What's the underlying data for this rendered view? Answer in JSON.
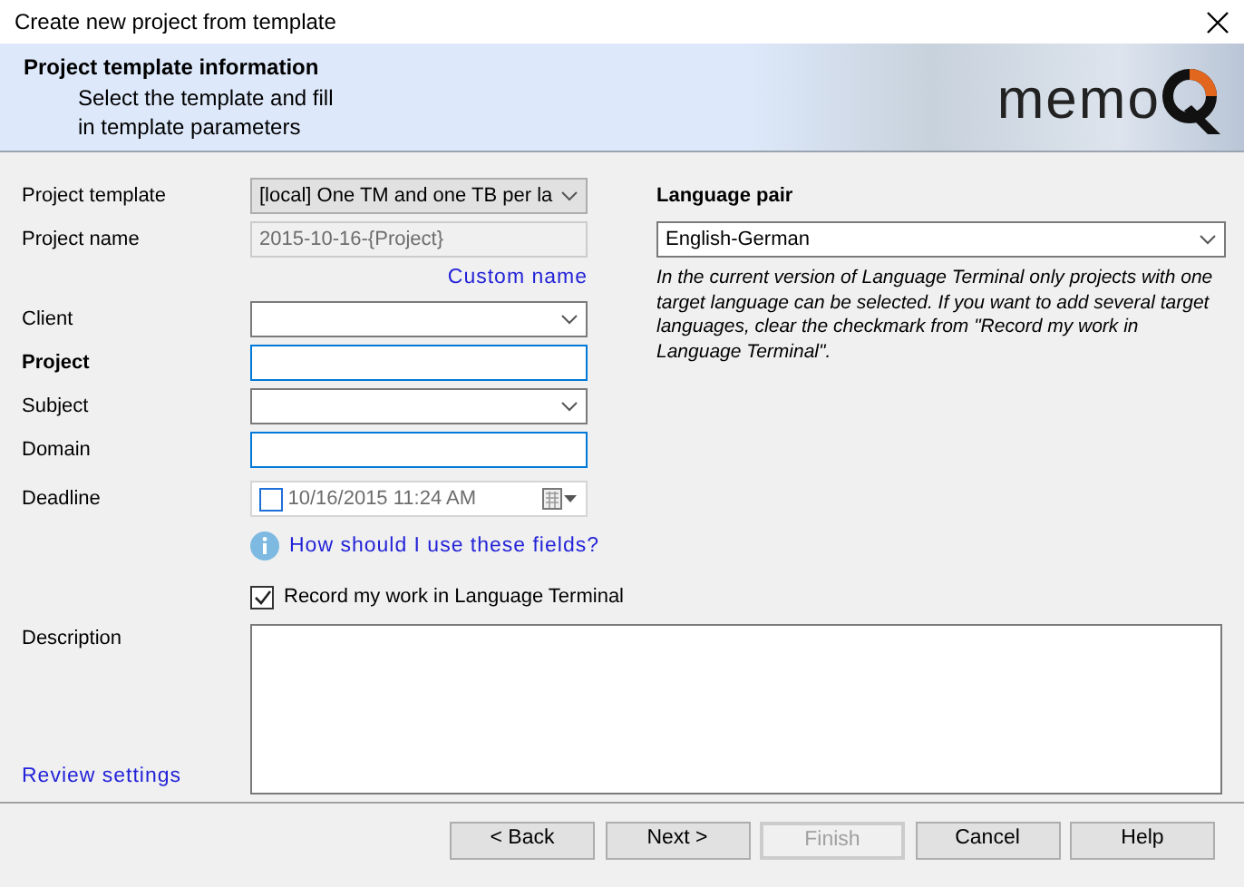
{
  "window": {
    "title": "Create new project from template"
  },
  "header": {
    "title": "Project template information",
    "subtitle_lines": [
      "Select the template and fill",
      "in template parameters"
    ],
    "logo_text": "memo"
  },
  "fields": [
    {
      "label": "Project template",
      "kind": "dropdown",
      "value": "[local] One TM and one TB per la",
      "disabled": true,
      "highlighted": false,
      "label_bold": false
    },
    {
      "label": "Project name",
      "kind": "text",
      "value": "2015-10-16-{Project}",
      "disabled": true,
      "highlighted": false,
      "label_bold": false
    },
    {
      "label": "Client",
      "kind": "dropdown",
      "disabled": false,
      "highlighted": false,
      "label_bold": false
    },
    {
      "label": "Project",
      "kind": "text",
      "disabled": false,
      "highlighted": true,
      "label_bold": true
    },
    {
      "label": "Subject",
      "kind": "dropdown",
      "disabled": false,
      "highlighted": false,
      "label_bold": false
    },
    {
      "label": "Domain",
      "kind": "text",
      "disabled": false,
      "highlighted": true,
      "label_bold": false
    },
    {
      "label": "Deadline",
      "kind": "date",
      "value": "10/16/2015 11:24 AM",
      "checked": false,
      "disabled": false,
      "highlighted": false,
      "label_bold": false
    }
  ],
  "custom_name_link": "Custom name",
  "help_link": "How should I use these fields?",
  "record_checkbox": {
    "label": "Record my work in Language Terminal",
    "checked": true
  },
  "language_pair": {
    "label": "Language pair",
    "value": "English-German",
    "note": "In the current version of Language Terminal only projects with one target language can be selected. If you want to add several target languages, clear the checkmark from \"Record my work in Language Terminal\"."
  },
  "description": {
    "label": "Description"
  },
  "review_link": "Review settings",
  "buttons": [
    {
      "label": "< Back",
      "disabled": false
    },
    {
      "label": "Next >",
      "disabled": false
    },
    {
      "label": "Finish",
      "disabled": true
    },
    {
      "label": "Cancel",
      "disabled": false
    },
    {
      "label": "Help",
      "disabled": false
    }
  ]
}
